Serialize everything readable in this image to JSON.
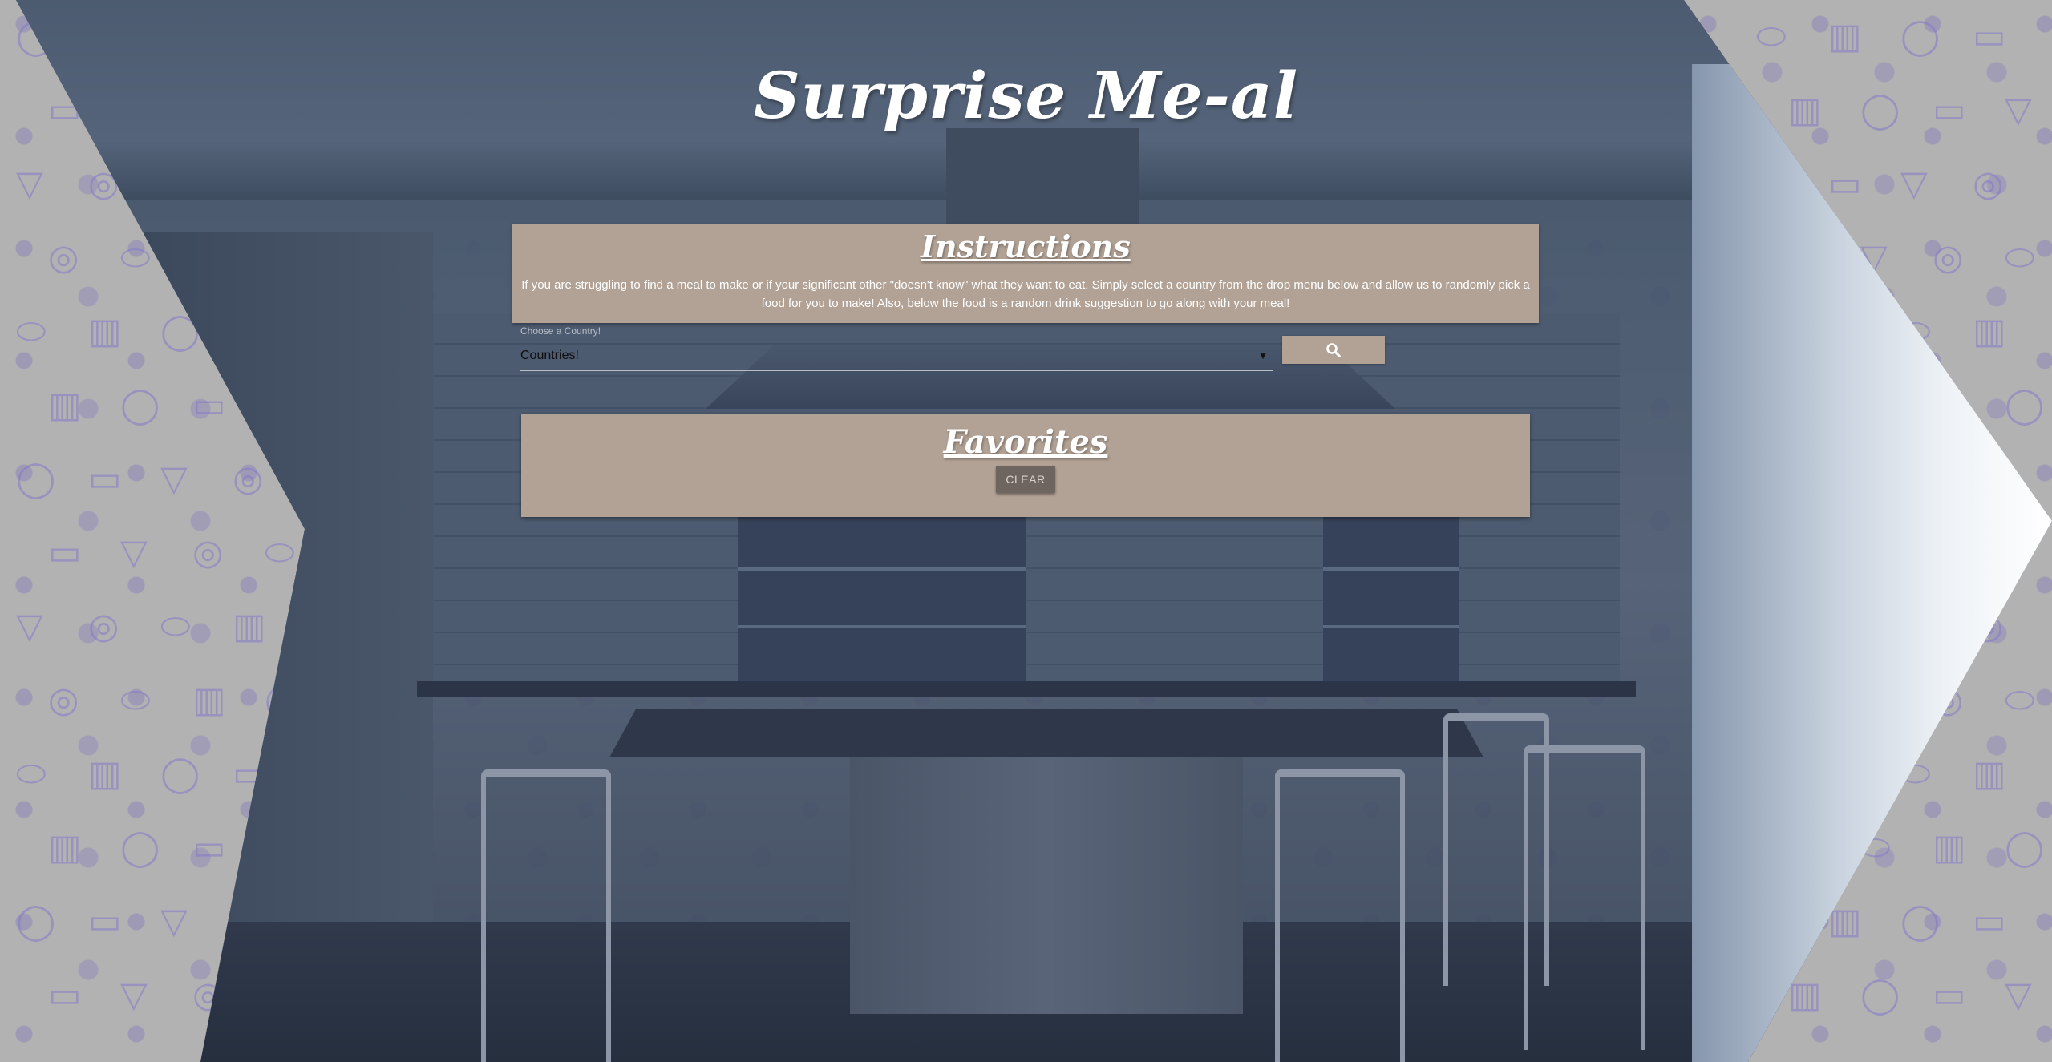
{
  "app": {
    "title": "Surprise Me-al"
  },
  "instructions": {
    "heading": "Instructions",
    "text": "If you are struggling to find a meal to make or if your significant other \"doesn't know\" what they want to eat. Simply select a country from the drop menu below and allow us to randomly pick a food for you to make! Also, below the food is a random drink suggestion to go along with your meal!"
  },
  "country_picker": {
    "label": "Choose a Country!",
    "selected": "Countries!"
  },
  "search": {
    "icon": "search-icon"
  },
  "favorites": {
    "heading": "Favorites",
    "clear_label": "CLEAR"
  },
  "colors": {
    "panel": "#b2a295",
    "clear_button": "#6e6560",
    "pattern_icons": "#8278c8"
  }
}
